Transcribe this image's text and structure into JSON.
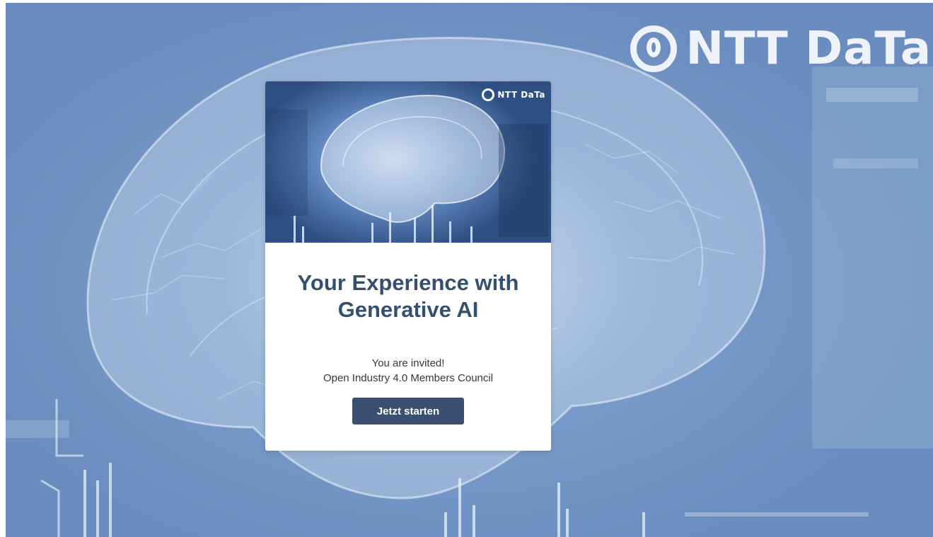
{
  "brand": {
    "logo_text": "NTT DaTa",
    "icon": "ntt-data-ring-icon"
  },
  "card": {
    "hero_logo_text": "NTT DaTa",
    "title_line1": "Your Experience with",
    "title_line2": "Generative AI",
    "invite_line1": "You are invited!",
    "invite_line2": "Open Industry 4.0 Members Council",
    "cta_label": "Jetzt starten"
  },
  "colors": {
    "background": "#7a9ccb",
    "title": "#34506e",
    "button": "#3b5070",
    "button_text": "#ffffff"
  }
}
